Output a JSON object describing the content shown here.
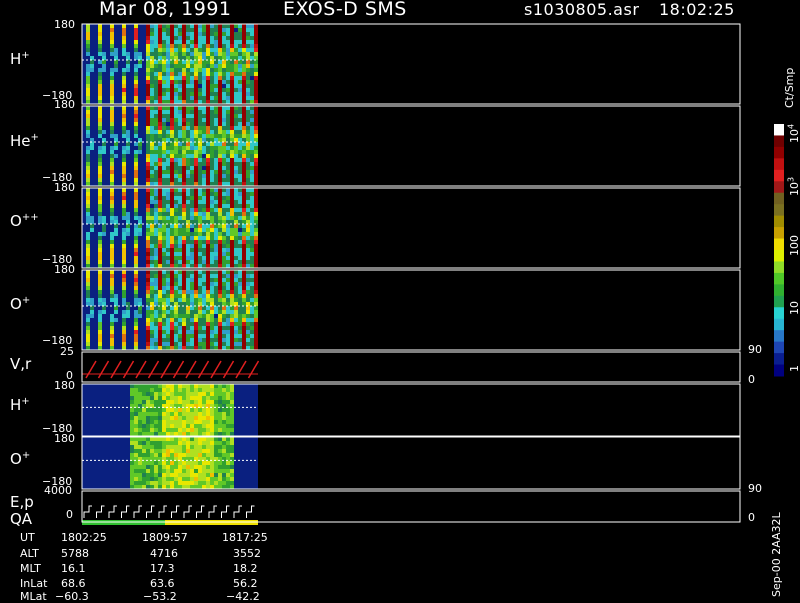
{
  "header": {
    "date": "Mar 08, 1991",
    "instrument": "EXOS-D SMS",
    "file": "s1030805.asr",
    "time": "18:02:25"
  },
  "panels": [
    {
      "id": "H+",
      "base": "H",
      "sup": "+",
      "ytop": "180",
      "ybot": "−180"
    },
    {
      "id": "He+",
      "base": "He",
      "sup": "+",
      "ytop": "180",
      "ybot": "−180"
    },
    {
      "id": "O++",
      "base": "O",
      "sup": "++",
      "ytop": "180",
      "ybot": "−180"
    },
    {
      "id": "O+",
      "base": "O",
      "sup": "+",
      "ytop": "180",
      "ybot": "−180"
    },
    {
      "id": "V,r",
      "base": "V,r",
      "sup": "",
      "ytop": "25",
      "ybot": "0",
      "rtop": "90",
      "rbot": "0"
    },
    {
      "id": "H+2",
      "base": "H",
      "sup": "+",
      "ytop": "180",
      "ybot": "−180"
    },
    {
      "id": "O+2",
      "base": "O",
      "sup": "+",
      "ytop": "180",
      "ybot": "−180"
    },
    {
      "id": "E,p",
      "base": "E,p",
      "sup": "",
      "ytop": "4000",
      "ybot": "0",
      "rtop": "90",
      "rbot": "0"
    }
  ],
  "qa_label": "QA",
  "colorbar": {
    "unit": "Ct/Smp",
    "ticks": [
      {
        "text": "1"
      },
      {
        "text": "10"
      },
      {
        "text": "100"
      },
      {
        "text": "10",
        "sup": "3"
      },
      {
        "text": "10",
        "sup": "4"
      }
    ],
    "colors": [
      "#000080",
      "#0a1e90",
      "#1e46b4",
      "#2878c8",
      "#28b4d2",
      "#28d2d2",
      "#20a050",
      "#30b030",
      "#50c828",
      "#90dc28",
      "#dcf000",
      "#f0dc00",
      "#c8a000",
      "#a08c00",
      "#7a7020",
      "#706020",
      "#a01818",
      "#e02020",
      "#c01010",
      "#900000",
      "#700000",
      "#ffffff"
    ]
  },
  "sidebar_note": "Sep-00 2AA32L",
  "orbit_table": {
    "rows": [
      {
        "label": "UT",
        "values": [
          "1802:25",
          "1809:57",
          "1817:25"
        ]
      },
      {
        "label": "ALT",
        "values": [
          "5788",
          "4716",
          "3552"
        ]
      },
      {
        "label": "MLT",
        "values": [
          "16.1",
          "17.3",
          "18.2"
        ]
      },
      {
        "label": "InLat",
        "values": [
          "68.6",
          "63.6",
          "56.2"
        ]
      },
      {
        "label": "MLat",
        "values": [
          "−60.3",
          "−53.2",
          "−42.2"
        ]
      }
    ]
  },
  "chart_data": {
    "type": "heatmap",
    "title": "Mar 08, 1991   EXOS-D SMS   s1030805.asr  18:02:25",
    "x_label": "UT",
    "x_ticks": [
      "1802:25",
      "1809:57",
      "1817:25"
    ],
    "colorbar_label": "Ct/Smp",
    "colorbar_scale": "log",
    "colorbar_range": [
      1,
      10000
    ],
    "panels": [
      {
        "name": "H+",
        "ylim": [
          -180,
          180
        ],
        "data_fraction_of_time": 0.263
      },
      {
        "name": "He+",
        "ylim": [
          -180,
          180
        ],
        "data_fraction_of_time": 0.263
      },
      {
        "name": "O++",
        "ylim": [
          -180,
          180
        ],
        "data_fraction_of_time": 0.263
      },
      {
        "name": "O+",
        "ylim": [
          -180,
          180
        ],
        "data_fraction_of_time": 0.263
      },
      {
        "name": "V,r",
        "ylim": [
          0,
          25
        ],
        "ylim_right": [
          0,
          90
        ],
        "type": "line"
      },
      {
        "name": "H+",
        "ylim": [
          -180,
          180
        ],
        "data_fraction_of_time": 0.263
      },
      {
        "name": "O+",
        "ylim": [
          -180,
          180
        ],
        "data_fraction_of_time": 0.263
      },
      {
        "name": "E,p",
        "ylim": [
          0,
          4000
        ],
        "ylim_right": [
          0,
          90
        ],
        "type": "line"
      }
    ]
  }
}
